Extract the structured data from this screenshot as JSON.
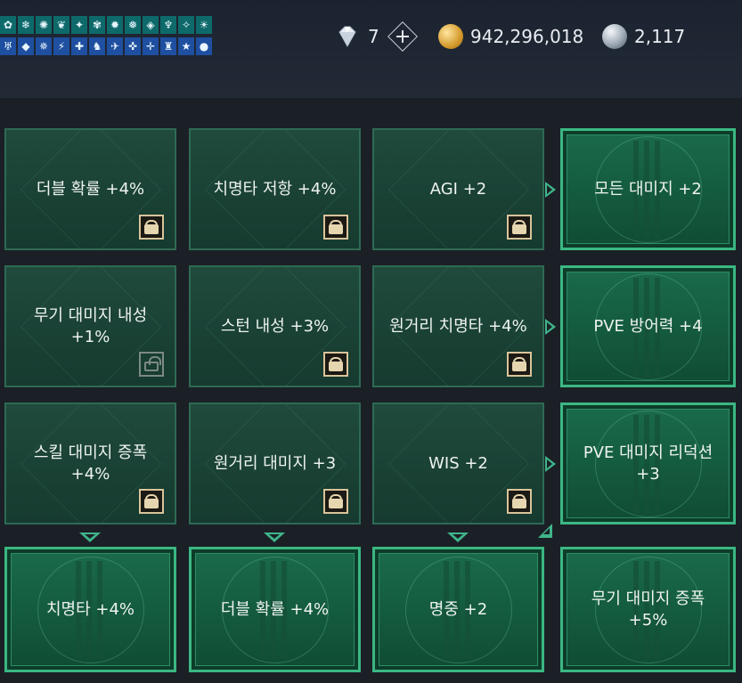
{
  "header": {
    "buff_icons": [
      "leaf-icon",
      "snowflake-icon",
      "swirl-icon",
      "flame-icon",
      "claw-icon",
      "vine-icon",
      "gear-icon",
      "frost-icon",
      "shield-icon",
      "horn-icon",
      "feather-icon",
      "sun-icon",
      "wing-icon",
      "drop-icon",
      "spiral-icon",
      "bolt-icon",
      "sword-icon",
      "wolf-icon",
      "bird-icon",
      "cross-icon",
      "plus-icon",
      "boot-icon",
      "star-icon",
      "orb-icon"
    ],
    "diamond": {
      "icon": "diamond-icon",
      "value": "7"
    },
    "gold": {
      "icon": "gold-coin-icon",
      "value": "942,296,018"
    },
    "silver": {
      "icon": "silver-orb-icon",
      "value": "2,117"
    }
  },
  "colors": {
    "node_border": "#2e6a54",
    "active_border": "#3bb783",
    "connector": "#3fb58a",
    "lock_gold": "#d8c49a",
    "background": "#1b2026"
  },
  "nodes": [
    {
      "label": "더블 확률 +4%",
      "state": "locked"
    },
    {
      "label": "치명타 저항 +4%",
      "state": "locked"
    },
    {
      "label": "AGI +2",
      "state": "locked"
    },
    {
      "label": "모든 대미지 +2",
      "state": "active"
    },
    {
      "label": "무기 대미지 내성 +1%",
      "state": "unlockable"
    },
    {
      "label": "스턴 내성 +3%",
      "state": "locked"
    },
    {
      "label": "원거리 치명타 +4%",
      "state": "locked"
    },
    {
      "label": "PVE 방어력 +4",
      "state": "active"
    },
    {
      "label": "스킬 대미지 증폭 +4%",
      "state": "locked"
    },
    {
      "label": "원거리 대미지 +3",
      "state": "locked"
    },
    {
      "label": "WIS +2",
      "state": "locked"
    },
    {
      "label": "PVE 대미지 리덕션 +3",
      "state": "active"
    },
    {
      "label": "치명타 +4%",
      "state": "active"
    },
    {
      "label": "더블 확률 +4%",
      "state": "active"
    },
    {
      "label": "명중 +2",
      "state": "active"
    },
    {
      "label": "무기 대미지 증폭 +5%",
      "state": "active"
    }
  ]
}
